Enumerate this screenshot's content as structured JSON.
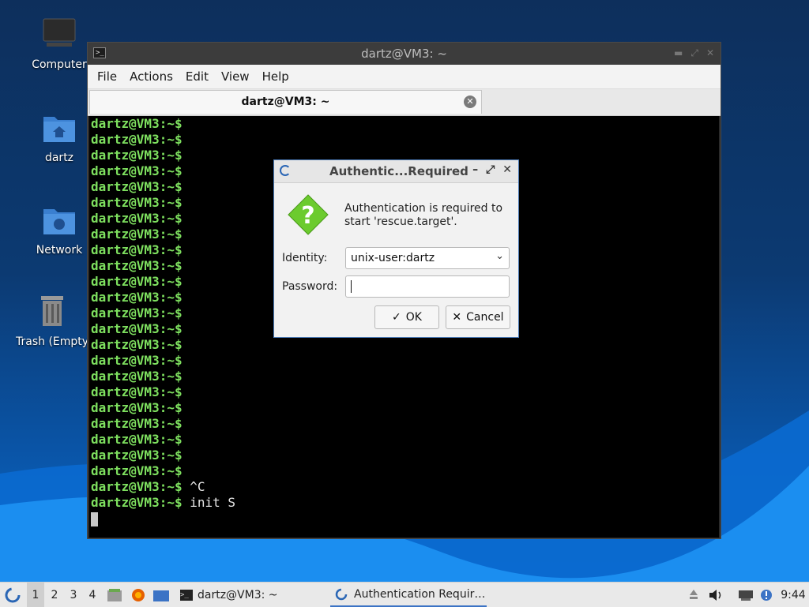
{
  "desktop": {
    "icons": [
      {
        "label": "Computer",
        "icon": "computer-icon"
      },
      {
        "label": "dartz",
        "icon": "home-folder-icon"
      },
      {
        "label": "Network",
        "icon": "network-folder-icon"
      },
      {
        "label": "Trash (Empty)",
        "icon": "trash-icon"
      }
    ]
  },
  "terminal": {
    "window_title": "dartz@VM3: ~",
    "menu": [
      "File",
      "Actions",
      "Edit",
      "View",
      "Help"
    ],
    "tab_title": "dartz@VM3: ~",
    "prompt": "dartz@VM3:~$",
    "lines": [
      {
        "cmd": ""
      },
      {
        "cmd": ""
      },
      {
        "cmd": ""
      },
      {
        "cmd": ""
      },
      {
        "cmd": ""
      },
      {
        "cmd": ""
      },
      {
        "cmd": ""
      },
      {
        "cmd": ""
      },
      {
        "cmd": ""
      },
      {
        "cmd": ""
      },
      {
        "cmd": ""
      },
      {
        "cmd": ""
      },
      {
        "cmd": ""
      },
      {
        "cmd": ""
      },
      {
        "cmd": ""
      },
      {
        "cmd": ""
      },
      {
        "cmd": ""
      },
      {
        "cmd": ""
      },
      {
        "cmd": ""
      },
      {
        "cmd": ""
      },
      {
        "cmd": ""
      },
      {
        "cmd": ""
      },
      {
        "cmd": ""
      },
      {
        "cmd": " ^C"
      },
      {
        "cmd": " init S"
      }
    ]
  },
  "auth_dialog": {
    "title": "Authentic...Required",
    "message": "Authentication is required to start 'rescue.target'.",
    "identity_label": "Identity:",
    "identity_value": "unix-user:dartz",
    "password_label": "Password:",
    "password_value": "",
    "ok_label": "OK",
    "cancel_label": "Cancel"
  },
  "taskbar": {
    "workspaces": [
      "1",
      "2",
      "3",
      "4"
    ],
    "active_workspace": "1",
    "tasks": [
      {
        "label": "dartz@VM3: ~",
        "icon": "terminal-icon"
      },
      {
        "label": "Authentication Requir…",
        "icon": "lxqt-icon"
      }
    ],
    "clock": "9:44"
  },
  "colors": {
    "prompt_green": "#7ee05f",
    "dialog_border": "#4a7ab7",
    "question_green": "#6ccb2e"
  }
}
